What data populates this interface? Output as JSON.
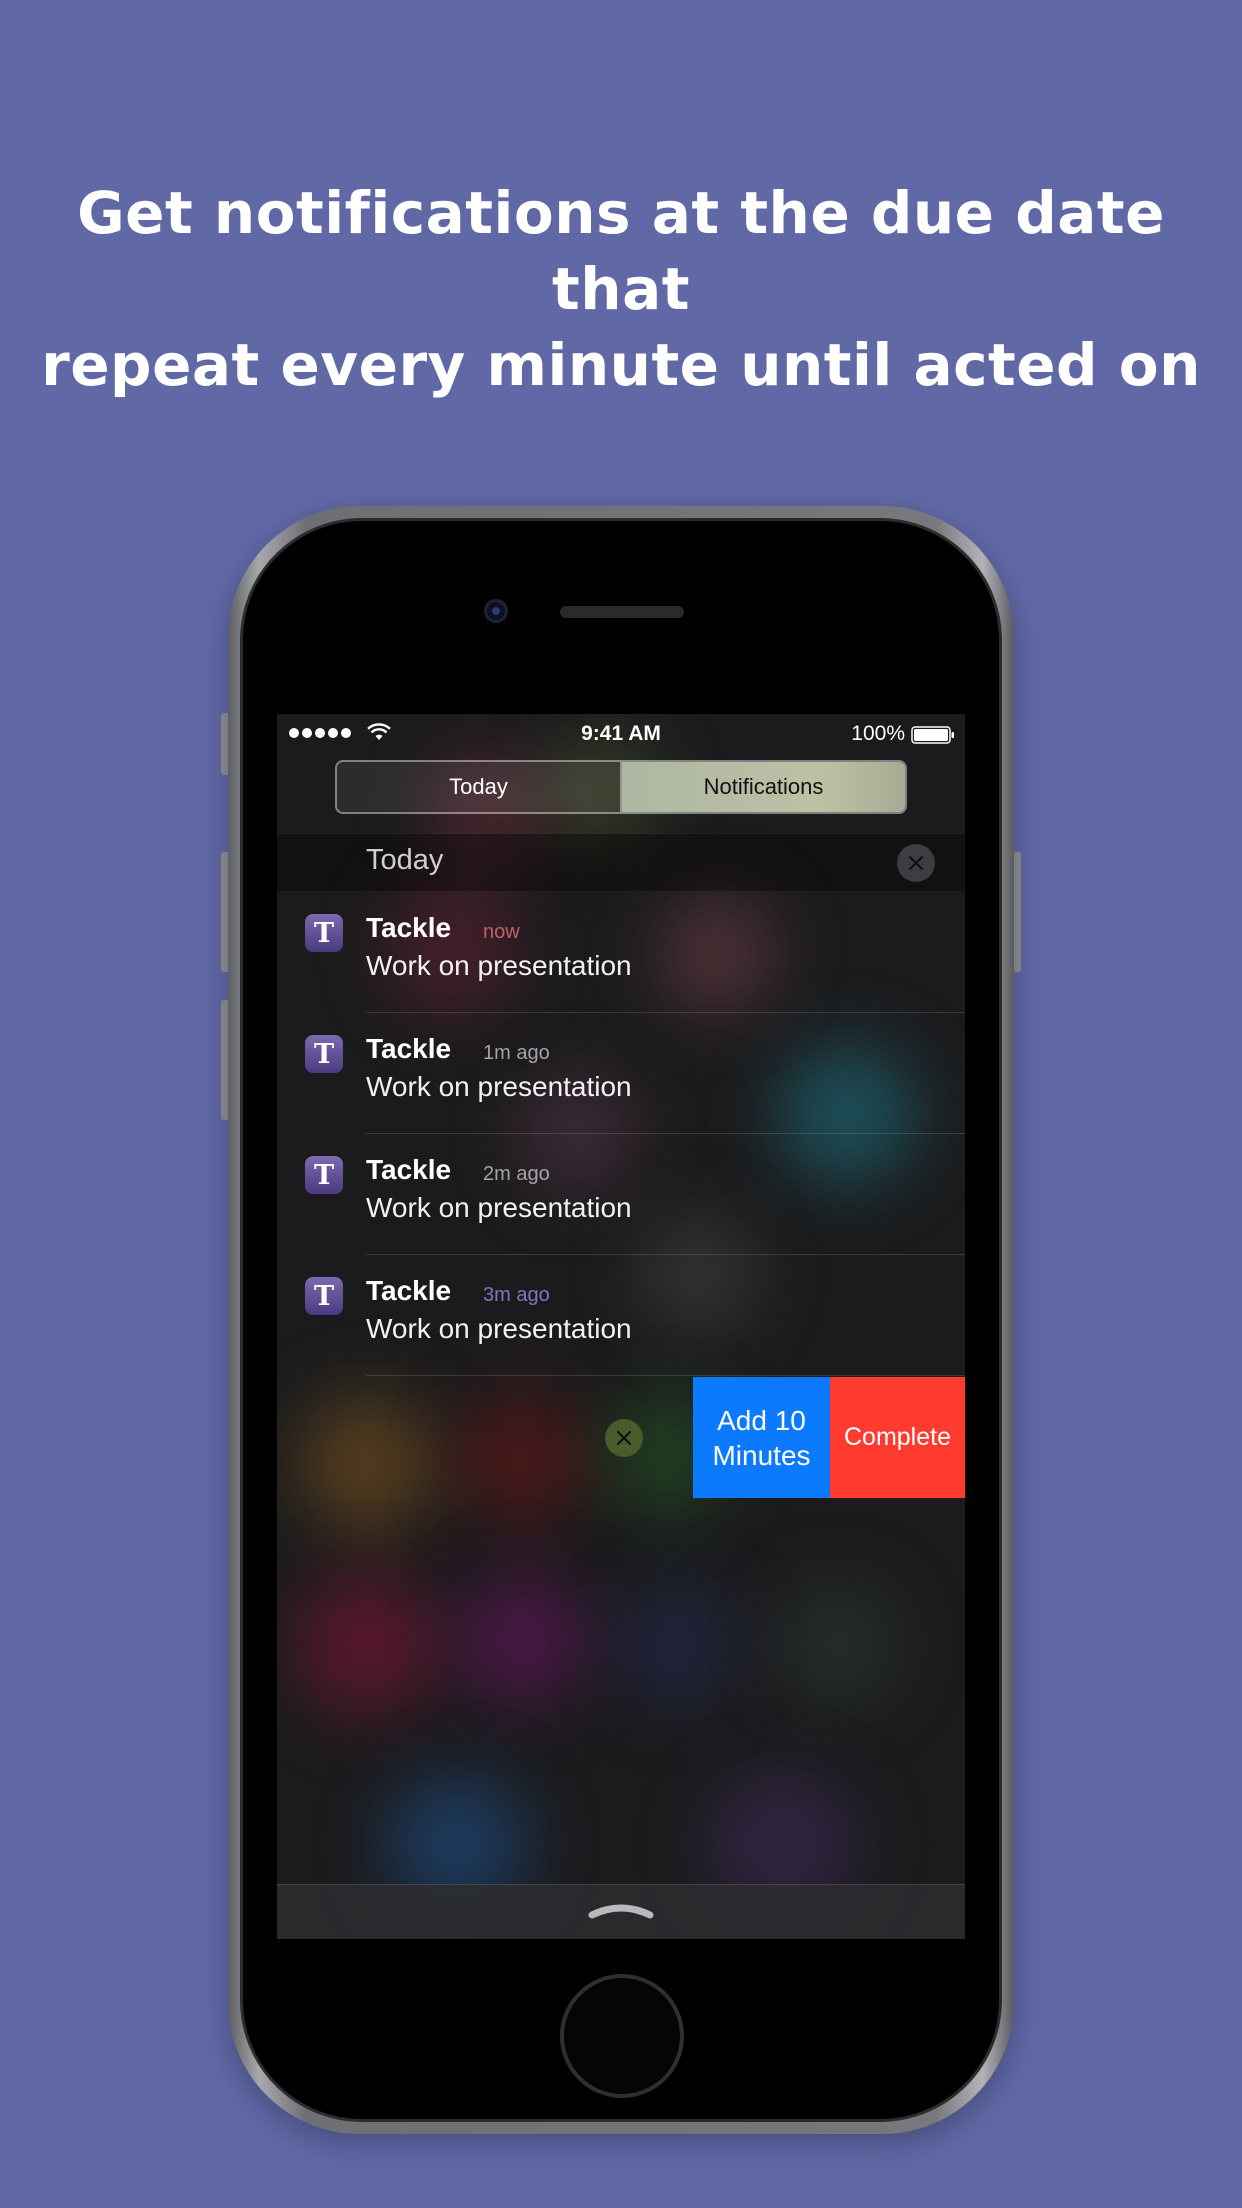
{
  "headline": {
    "line1": "Get notifications at the due date that",
    "line2": "repeat every minute until acted on"
  },
  "status_bar": {
    "time": "9:41 AM",
    "battery": "100%",
    "signal_icon": "signal-dots-icon",
    "wifi_icon": "wifi-icon",
    "battery_icon": "battery-icon"
  },
  "segmented_control": {
    "today_label": "Today",
    "notifications_label": "Notifications",
    "selected": "Notifications"
  },
  "section": {
    "title": "Today",
    "clear_icon": "close-icon"
  },
  "notifications": [
    {
      "app": "Tackle",
      "icon_letter": "T",
      "time": "now",
      "time_color": "#c0606a",
      "message": "Work on presentation"
    },
    {
      "app": "Tackle",
      "icon_letter": "T",
      "time": "1m ago",
      "time_color": "#a3a3a8",
      "message": "Work on presentation"
    },
    {
      "app": "Tackle",
      "icon_letter": "T",
      "time": "2m ago",
      "time_color": "#a3a3a8",
      "message": "Work on presentation"
    },
    {
      "app": "Tackle",
      "icon_letter": "T",
      "time": "3m ago",
      "time_color": "#8a6fc2",
      "message": "Work on presentation"
    }
  ],
  "swipe_actions": {
    "add_label_line1": "Add 10",
    "add_label_line2": "Minutes",
    "complete_label": "Complete",
    "add_color": "#0b7aff",
    "complete_color": "#ff3b30"
  },
  "colors": {
    "background": "#6068a6",
    "app_icon": "#5a4a90"
  },
  "bottom_bar": {
    "grabber_icon": "chevron-up-icon"
  }
}
